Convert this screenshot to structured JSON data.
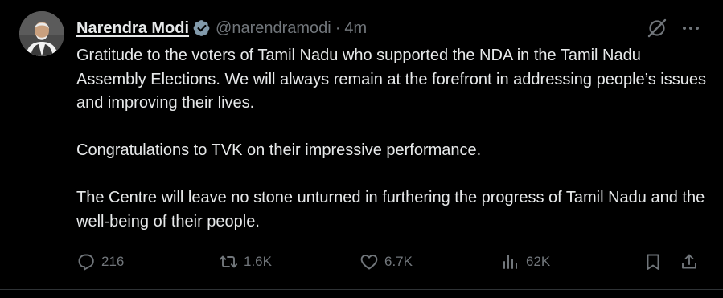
{
  "tweet": {
    "author_name": "Narendra Modi",
    "handle": "@narendramodi",
    "separator": "·",
    "time": "4m",
    "paragraphs": [
      "Gratitude to the voters of Tamil Nadu who supported the NDA in the Tamil Nadu Assembly Elections. We will always remain at the forefront in addressing people’s issues and improving their lives.",
      "Congratulations to TVK on their impressive performance.",
      "The Centre will leave no stone unturned in furthering the progress of Tamil Nadu and the well-being of their people."
    ],
    "stats": {
      "replies": "216",
      "reposts": "1.6K",
      "likes": "6.7K",
      "views": "62K"
    }
  },
  "icons": {
    "verified": "verified-badge-icon",
    "grok": "grok-icon",
    "more": "more-icon",
    "reply": "reply-icon",
    "repost": "repost-icon",
    "like": "heart-icon",
    "views": "views-icon",
    "bookmark": "bookmark-icon",
    "share": "share-icon"
  },
  "colors": {
    "background": "#000000",
    "text": "#e7e9ea",
    "muted": "#71767b",
    "verified_badge": "#829aab",
    "divider": "#2f3336"
  }
}
